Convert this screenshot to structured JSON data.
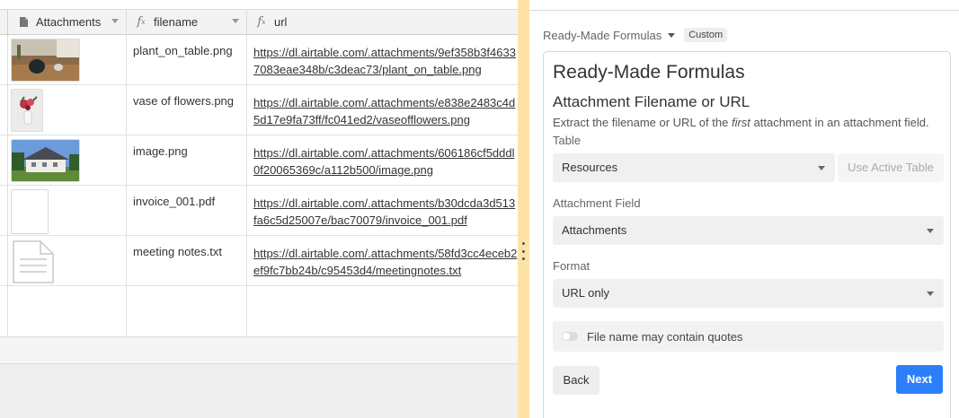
{
  "grid": {
    "columns": [
      {
        "label": "Attachments",
        "icon": "paperclip-document-icon"
      },
      {
        "label": "filename",
        "icon": "formula-fx-icon"
      },
      {
        "label": "url",
        "icon": "formula-fx-icon"
      }
    ],
    "rows": [
      {
        "thumbnail": "photo-plant-on-table",
        "filename": "plant_on_table.png",
        "url_line1": "https://dl.airtable.com/.attachments/9ef358b3f4633",
        "url_line2": "7083eae348b/c3deac73/plant_on_table.png"
      },
      {
        "thumbnail": "photo-vase-of-flowers",
        "filename": "vase of flowers.png",
        "url_line1": "https://dl.airtable.com/.attachments/e838e2483c4d",
        "url_line2": "5d17e9fa73ff/fc041ed2/vaseofflowers.png"
      },
      {
        "thumbnail": "photo-house",
        "filename": "image.png",
        "url_line1": "https://dl.airtable.com/.attachments/606186cf5dddl",
        "url_line2": "0f20065369c/a112b500/image.png"
      },
      {
        "thumbnail": "blank-pdf-page",
        "filename": "invoice_001.pdf",
        "url_line1": "https://dl.airtable.com/.attachments/b30dcda3d513",
        "url_line2": "fa6c5d25007e/bac70079/invoice_001.pdf"
      },
      {
        "thumbnail": "text-document-icon",
        "filename": "meeting notes.txt",
        "url_line1": "https://dl.airtable.com/.attachments/58fd3cc4eceb2",
        "url_line2": "ef9fc7bb24b/c95453d4/meetingnotes.txt"
      }
    ]
  },
  "panel": {
    "breadcrumb": "Ready-Made Formulas",
    "badge": "Custom",
    "title": "Ready-Made Formulas",
    "subtitle": "Attachment Filename or URL",
    "description_before": "Extract the filename or URL of the ",
    "description_em": "first",
    "description_after": " attachment in an attachment field.",
    "table_label": "Table",
    "table_value": "Resources",
    "use_active_table": "Use Active Table",
    "field_label": "Attachment Field",
    "field_value": "Attachments",
    "format_label": "Format",
    "format_value": "URL only",
    "toggle_label": "File name may contain quotes",
    "toggle_on": false,
    "back_label": "Back",
    "next_label": "Next"
  },
  "colors": {
    "divider": "#fde4a6",
    "primary_button": "#2d7ff9"
  }
}
